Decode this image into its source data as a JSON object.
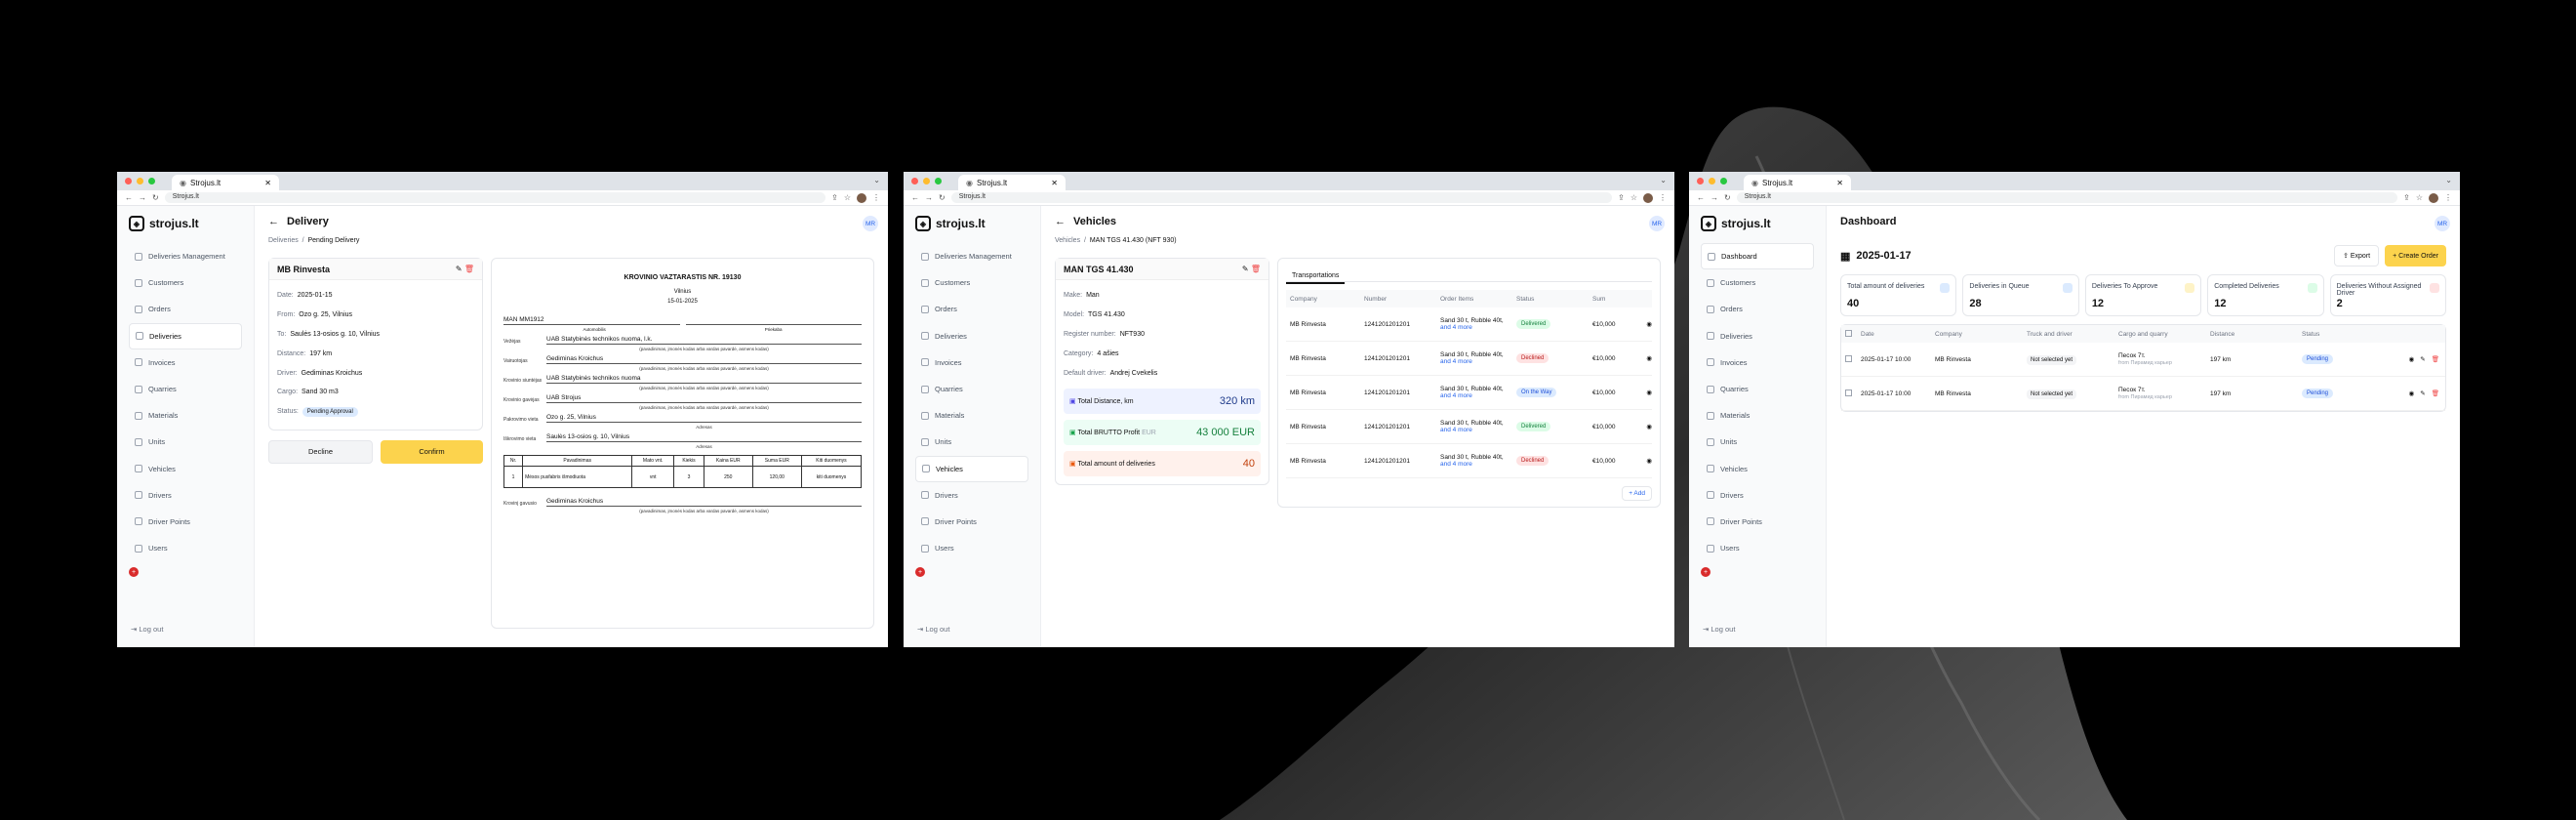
{
  "browser": {
    "tab_title": "Strojus.lt",
    "url": "Strojus.lt"
  },
  "app": {
    "logo": "strojus.lt",
    "avatar": "MR",
    "logout": "Log out",
    "flag": "GE"
  },
  "sidebar": {
    "items": [
      "Deliveries Management",
      "Customers",
      "Orders",
      "Deliveries",
      "Invoices",
      "Quarries",
      "Materials",
      "Units",
      "Vehicles",
      "Drivers",
      "Driver Points",
      "Users"
    ]
  },
  "dash_sidebar": {
    "items": [
      "Dashboard",
      "Customers",
      "Orders",
      "Deliveries",
      "Invoices",
      "Quarries",
      "Materials",
      "Units",
      "Vehicles",
      "Drivers",
      "Driver Points",
      "Users"
    ]
  },
  "delivery": {
    "title": "Delivery",
    "crumb_parent": "Deliveries",
    "crumb_current": "Pending Delivery",
    "card_title": "MB Rinvesta",
    "fields": [
      {
        "k": "Date:",
        "v": "2025-01-15"
      },
      {
        "k": "From:",
        "v": "Ozo g. 25, Vilnius"
      },
      {
        "k": "To:",
        "v": "Saulės 13-osios g. 10, Vilnius"
      },
      {
        "k": "Distance:",
        "v": "197 km"
      },
      {
        "k": "Driver:",
        "v": "Gediminas Kroichus"
      },
      {
        "k": "Cargo:",
        "v": "Sand 30 m3"
      }
    ],
    "status_label": "Status:",
    "status": "Pending Approval",
    "decline": "Decline",
    "confirm": "Confirm",
    "doc": {
      "title": "KROVINIO VAZTARASTIS NR. 19130",
      "city": "Vilnius",
      "date": "15-01-2025",
      "car": "MAN MM1912",
      "car_label": "Automobilis",
      "trailer_label": "Priekaba",
      "rows": [
        {
          "k": "Vežėjas",
          "v": "UAB Statybinės technikos nuoma, l.k.",
          "sub": "(pavadinimas, įmonės kodas arba vardas pavardė, asmens kodas)"
        },
        {
          "k": "Vairuotojas",
          "v": "Gediminas Kroichus",
          "sub": "(pavadinimas, įmonės kodas arba vardas pavardė, asmens kodas)"
        },
        {
          "k": "Krovinio siuntėjas",
          "v": "UAB Statybinės technikos nuoma",
          "sub": "(pavadinimas, įmonės kodas arba vardas pavardė, asmens kodas)"
        },
        {
          "k": "Krovinio gavėjas",
          "v": "UAB Strojus",
          "sub": "(pavadinimas, įmonės kodas arba vardas pavardė, asmens kodas)"
        },
        {
          "k": "Pakrovimo vieta",
          "v": "Ozo g. 25, Vilnius",
          "sub": "Adresas"
        },
        {
          "k": "Iškrovimo vieta",
          "v": "Saulės 13-osios g. 10, Vilnius",
          "sub": "Adresas"
        }
      ],
      "table_head": [
        "Nr.",
        "Pavadinimas",
        "Mato vnt.",
        "Kiekis",
        "Kaina EUR",
        "Suma EUR",
        "Kiti duomenys"
      ],
      "table_row": [
        "1",
        "Mėsos pusfabris išmodiuota",
        "vnt",
        "3",
        "250",
        "120,00",
        "kiti duomenys"
      ],
      "receiver_label": "Krovinį gavusio",
      "receiver": "Gediminas Kroichus",
      "receiver_sub": "(pavadinimas, įmonės kodas arba vardas pavardė, asmens kodas)"
    }
  },
  "vehicle": {
    "title": "Vehicles",
    "crumb_parent": "Vehicles",
    "crumb_current": "MAN TGS 41.430 (NFT 930)",
    "card_title": "MAN TGS 41.430",
    "fields": [
      {
        "k": "Make:",
        "v": "Man"
      },
      {
        "k": "Model:",
        "v": "TGS 41.430"
      },
      {
        "k": "Register number:",
        "v": "NFT930"
      },
      {
        "k": "Category:",
        "v": "4 ašies"
      },
      {
        "k": "Default driver:",
        "v": "Andrej Cvekelis"
      }
    ],
    "stats": [
      {
        "k": "Total Distance, km",
        "v": "320 km"
      },
      {
        "k": "Total BRUTTO Profit",
        "unit": "EUR",
        "v": "43 000 EUR"
      },
      {
        "k": "Total amount of deliveries",
        "v": "40"
      }
    ],
    "tab": "Transportations",
    "cols": [
      "Company",
      "Number",
      "Order Items",
      "Status",
      "Sum"
    ],
    "rows": [
      {
        "company": "MB Rinvesta",
        "number": "1241201201201",
        "item": "Sand 30 t, Rubble 40t,",
        "more": "and 4 more",
        "status": "Delivered",
        "sum": "€10,000"
      },
      {
        "company": "MB Rinvesta",
        "number": "1241201201201",
        "item": "Sand 30 t, Rubble 40t,",
        "more": "and 4 more",
        "status": "Declined",
        "sum": "€10,000"
      },
      {
        "company": "MB Rinvesta",
        "number": "1241201201201",
        "item": "Sand 30 t, Rubble 40t,",
        "more": "and 4 more",
        "status": "On the Way",
        "sum": "€10,000"
      },
      {
        "company": "MB Rinvesta",
        "number": "1241201201201",
        "item": "Sand 30 t, Rubble 40t,",
        "more": "and 4 more",
        "status": "Delivered",
        "sum": "€10,000"
      },
      {
        "company": "MB Rinvesta",
        "number": "1241201201201",
        "item": "Sand 30 t, Rubble 40t,",
        "more": "and 4 more",
        "status": "Declined",
        "sum": "€10,000"
      }
    ],
    "add": "+ Add"
  },
  "dashboard": {
    "title": "Dashboard",
    "date": "2025-01-17",
    "export": "Export",
    "create": "+ Create Order",
    "stats": [
      {
        "k": "Total amount of deliveries",
        "v": "40",
        "color": "#3b82f6"
      },
      {
        "k": "Deliveries in Queue",
        "v": "28",
        "color": "#3b82f6"
      },
      {
        "k": "Deliveries To Approve",
        "v": "12",
        "color": "#f59e0b"
      },
      {
        "k": "Completed Deliveries",
        "v": "12",
        "color": "#22c55e"
      },
      {
        "k": "Deliveries Without Assigned Driver",
        "v": "2",
        "color": "#ef4444"
      }
    ],
    "cols": [
      "Date",
      "Company",
      "Truck and driver",
      "Cargo and quarry",
      "Distance",
      "Status"
    ],
    "rows": [
      {
        "date": "2025-01-17 10:00",
        "company": "MB Rinvesta",
        "truck": "Not selected yet",
        "cargo": "Песок 7т.",
        "quarry": "from Пирамид карьер",
        "distance": "197 km",
        "status": "Pending"
      },
      {
        "date": "2025-01-17 10:00",
        "company": "MB Rinvesta",
        "truck": "Not selected yet",
        "cargo": "Песок 7т.",
        "quarry": "from Пирамид карьер",
        "distance": "197 km",
        "status": "Pending"
      }
    ]
  }
}
